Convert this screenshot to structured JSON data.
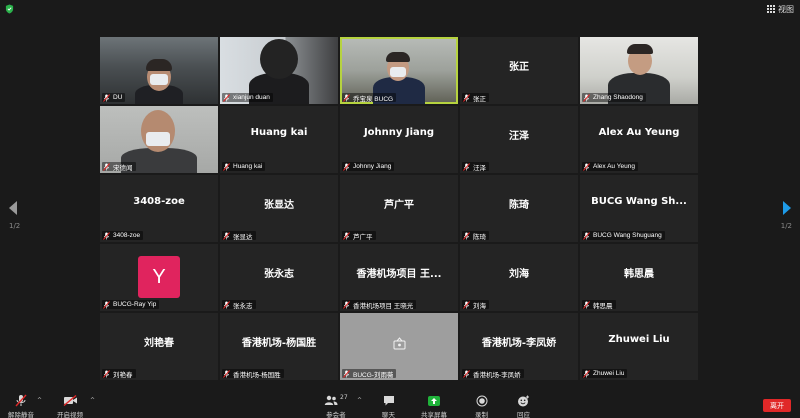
{
  "topbar": {
    "view_label": "视图"
  },
  "pagination": {
    "left": "1/2",
    "right": "1/2"
  },
  "tiles": [
    {
      "title": "",
      "label": "DU"
    },
    {
      "title": "",
      "label": "xianjun duan"
    },
    {
      "title": "",
      "label": "乔宝泉 BUCG"
    },
    {
      "title": "张正",
      "label": "张正"
    },
    {
      "title": "",
      "label": "Zhang Shaodong"
    },
    {
      "title": "",
      "label": "宋德闻"
    },
    {
      "title": "Huang kai",
      "label": "Huang kai"
    },
    {
      "title": "Johnny Jiang",
      "label": "Johnny Jiang"
    },
    {
      "title": "汪泽",
      "label": "汪泽"
    },
    {
      "title": "Alex Au Yeung",
      "label": "Alex Au Yeung"
    },
    {
      "title": "3408-zoe",
      "label": "3408-zoe"
    },
    {
      "title": "张显达",
      "label": "张显达"
    },
    {
      "title": "芦广平",
      "label": "芦广平"
    },
    {
      "title": "陈琦",
      "label": "陈琦"
    },
    {
      "title": "BUCG Wang Sh...",
      "label": "BUCG Wang Shuguang"
    },
    {
      "title": "",
      "label": "BUCG-Ray Yip",
      "avatar": "Y"
    },
    {
      "title": "张永志",
      "label": "张永志"
    },
    {
      "title": "香港机场项目 王...",
      "label": "香港机场项目 王晓光"
    },
    {
      "title": "刘海",
      "label": "刘海"
    },
    {
      "title": "韩思晨",
      "label": "韩思晨"
    },
    {
      "title": "刘艳春",
      "label": "刘艳春"
    },
    {
      "title": "香港机场-杨国胜",
      "label": "香港机场-杨国胜"
    },
    {
      "title": "",
      "label": "BUCG-刘雨薇"
    },
    {
      "title": "香港机场-李凤娇",
      "label": "香港机场-李凤娇"
    },
    {
      "title": "Zhuwei Liu",
      "label": "Zhuwei Liu"
    }
  ],
  "toolbar": {
    "unmute_label": "解除静音",
    "start_video_label": "开启视频",
    "participants_label": "参会者",
    "participants_count": "27",
    "chat_label": "聊天",
    "share_label": "共享屏幕",
    "record_label": "录制",
    "reactions_label": "回应",
    "end_label": "离开"
  },
  "colors": {
    "accent_active": "#b6d33f",
    "share_green": "#1fb33a",
    "end_red": "#e02828",
    "muted_red": "#e02828"
  },
  "icons": [
    "shield-icon",
    "grid-view-icon",
    "prev-page-icon",
    "next-page-icon",
    "mic-muted-icon",
    "video-off-icon",
    "participants-icon",
    "chat-icon",
    "share-screen-icon",
    "record-icon",
    "reactions-icon"
  ]
}
